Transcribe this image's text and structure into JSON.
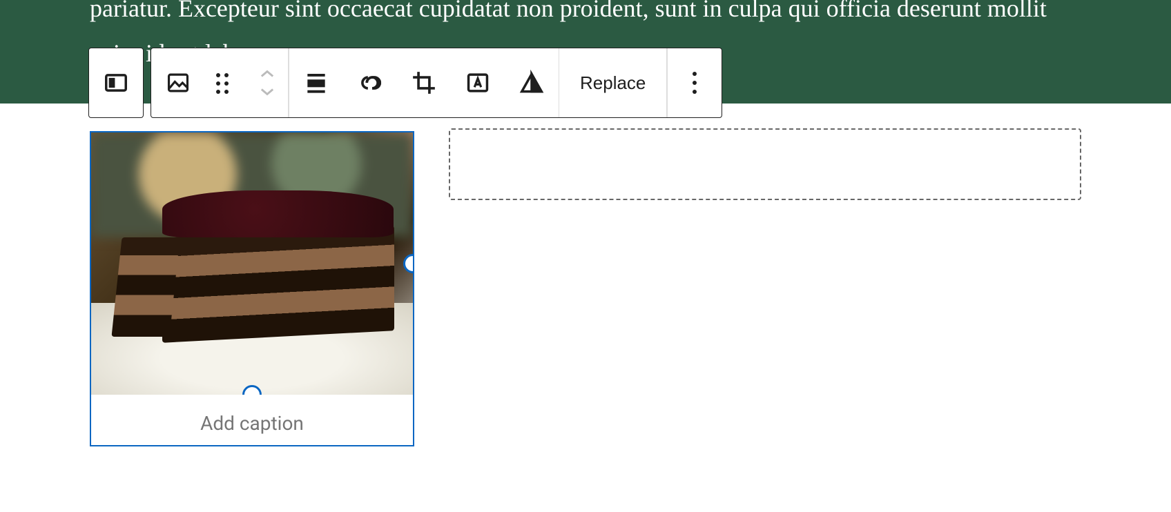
{
  "banner": {
    "text_fragment": "pariatur. Excepteur sint occaecat cupidatat non proident, sunt in culpa qui officia deserunt mollit anim id est laborum."
  },
  "toolbar": {
    "replace_label": "Replace"
  },
  "image_block": {
    "caption_placeholder": "Add caption",
    "alt": "chocolate cake slice"
  }
}
